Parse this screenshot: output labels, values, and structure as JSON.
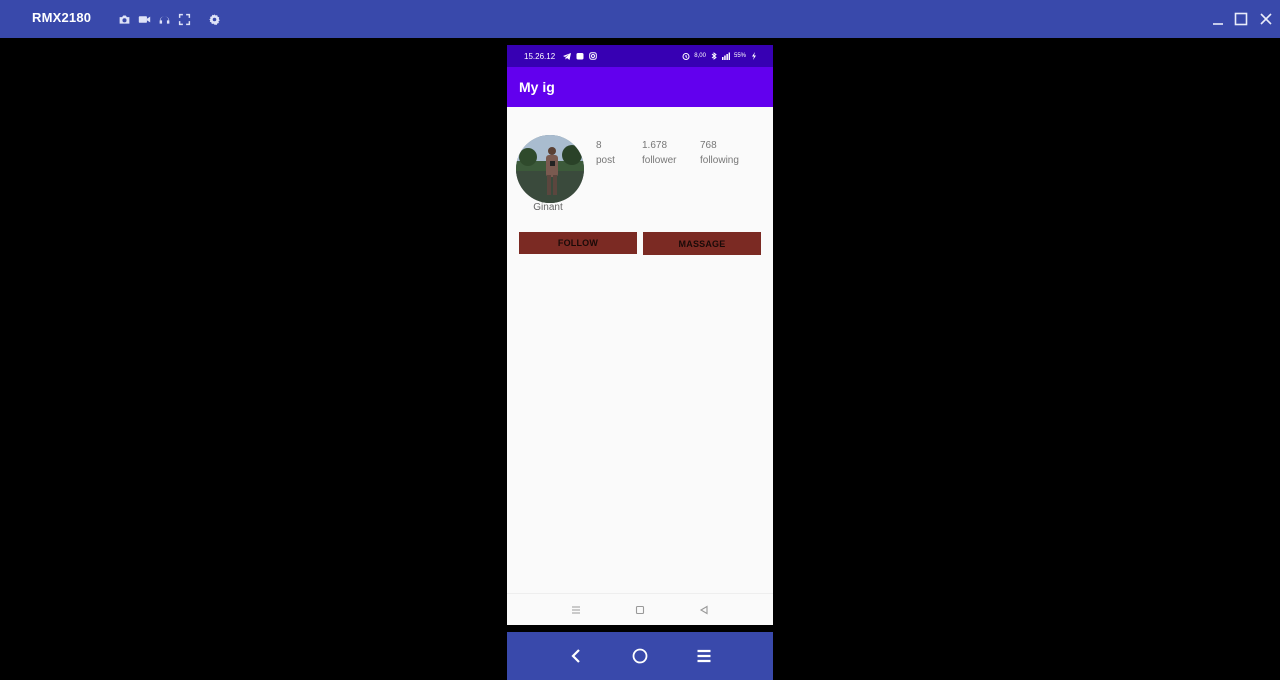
{
  "window": {
    "device_name": "RMX2180",
    "toolbar_icons": [
      "camera-icon",
      "video-icon",
      "headphones-icon",
      "fullscreen-icon",
      "settings-icon"
    ],
    "controls": [
      "minimize-icon",
      "maximize-icon",
      "close-icon"
    ]
  },
  "statusbar": {
    "time": "15.26.12",
    "left_icons": [
      "telegram-icon",
      "notification-icon",
      "instagram-icon"
    ],
    "right": {
      "data_speed": "8,00",
      "battery": "55%"
    }
  },
  "appbar": {
    "title": "My ig"
  },
  "profile": {
    "username": "Ginant",
    "stats": [
      {
        "value": "8",
        "label": "post"
      },
      {
        "value": "1.678",
        "label": "follower"
      },
      {
        "value": "768",
        "label": "following"
      }
    ],
    "buttons": {
      "follow": "FOLLOW",
      "message": "MASSAGE"
    }
  },
  "nav": [
    "recents-icon",
    "home-icon",
    "back-icon"
  ],
  "emulator_controls": [
    "back-arrow-icon",
    "home-circle-icon",
    "menu-icon"
  ],
  "colors": {
    "titlebar": "#3949ab",
    "statusbar": "#3700b3",
    "appbar": "#6200ee",
    "button": "#7b2a23",
    "screen_bg": "#fafafa"
  }
}
